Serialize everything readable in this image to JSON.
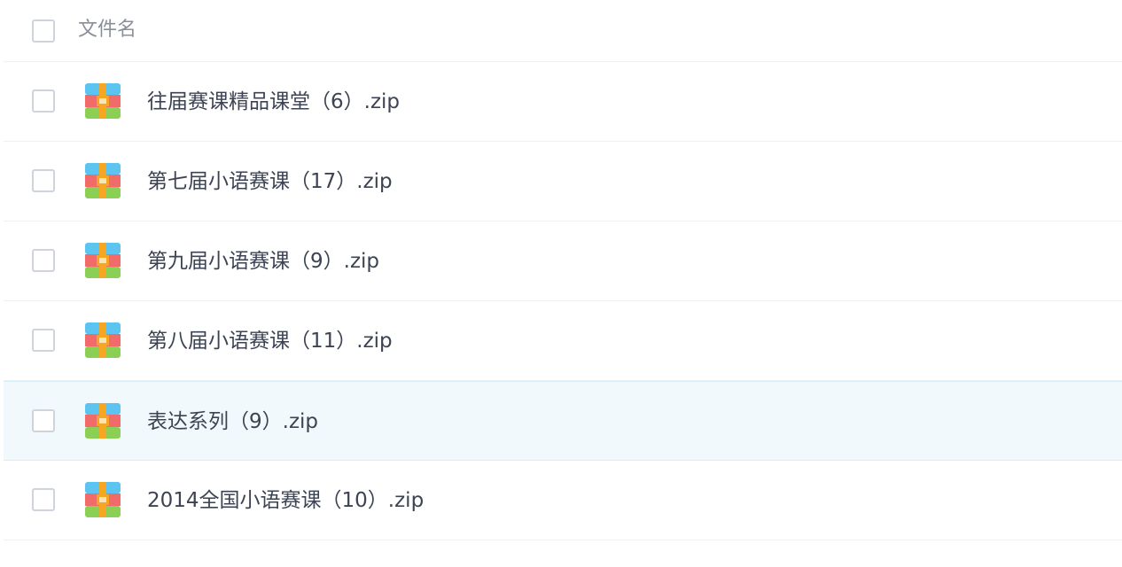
{
  "header": {
    "column_label": "文件名"
  },
  "files": [
    {
      "name": "往届赛课精品课堂（6）.zip",
      "icon": "zip-archive-icon"
    },
    {
      "name": "第七届小语赛课（17）.zip",
      "icon": "zip-archive-icon"
    },
    {
      "name": "第九届小语赛课（9）.zip",
      "icon": "zip-archive-icon"
    },
    {
      "name": "第八届小语赛课（11）.zip",
      "icon": "zip-archive-icon"
    },
    {
      "name": "表达系列（9）.zip",
      "icon": "zip-archive-icon",
      "highlighted": true
    },
    {
      "name": "2014全国小语赛课（10）.zip",
      "icon": "zip-archive-icon"
    }
  ],
  "colors": {
    "highlight_bg": "#f1f9fd",
    "text": "#3c4353",
    "header_text": "#8a8f99",
    "zip_top": "#5bc4f1",
    "zip_middle": "#f26b6b",
    "zip_bottom": "#8bd055",
    "zip_strap": "#f5a623"
  }
}
